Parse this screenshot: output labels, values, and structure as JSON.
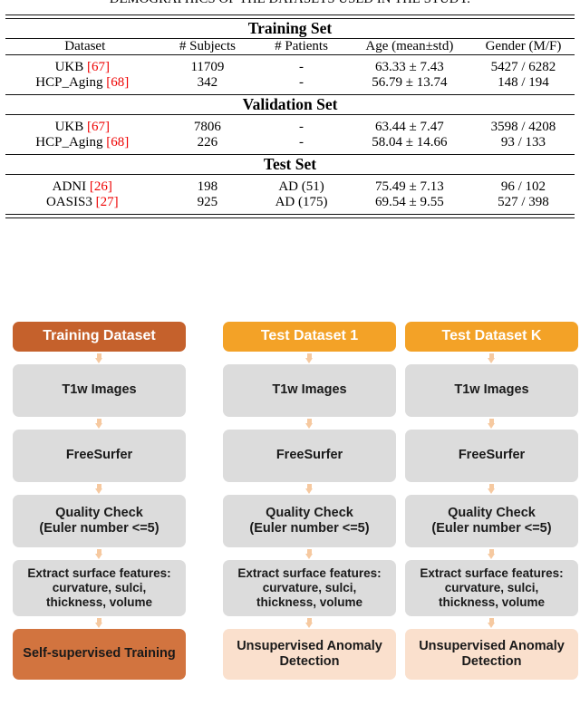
{
  "caption": "DEMOGRAPHICS OF THE DATASETS USED IN THE STUDY.",
  "table": {
    "columns": [
      "Dataset",
      "# Subjects",
      "# Patients",
      "Age (mean±std)",
      "Gender (M/F)"
    ],
    "sections": [
      {
        "title": "Training Set",
        "rows": [
          {
            "dataset": "UKB",
            "cite": "[67]",
            "subjects": "11709",
            "patients": "-",
            "age": "63.33 ± 7.43",
            "gender": "5427 / 6282"
          },
          {
            "dataset": "HCP_Aging",
            "cite": "[68]",
            "subjects": "342",
            "patients": "-",
            "age": "56.79 ± 13.74",
            "gender": "148 / 194"
          }
        ]
      },
      {
        "title": "Validation Set",
        "rows": [
          {
            "dataset": "UKB",
            "cite": "[67]",
            "subjects": "7806",
            "patients": "-",
            "age": "63.44 ± 7.47",
            "gender": "3598 / 4208"
          },
          {
            "dataset": "HCP_Aging",
            "cite": "[68]",
            "subjects": "226",
            "patients": "-",
            "age": "58.04 ± 14.66",
            "gender": "93 / 133"
          }
        ]
      },
      {
        "title": "Test Set",
        "rows": [
          {
            "dataset": "ADNI",
            "cite": "[26]",
            "subjects": "198",
            "patients": "AD (51)",
            "age": "75.49 ± 7.13",
            "gender": "96 / 102"
          },
          {
            "dataset": "OASIS3",
            "cite": "[27]",
            "subjects": "925",
            "patients": "AD (175)",
            "age": "69.54 ± 9.55",
            "gender": "527 / 398"
          }
        ]
      }
    ]
  },
  "flowchart": {
    "colors": {
      "training_header": "#c5612c",
      "test_header": "#f3a227",
      "process_box": "#dcdcdc",
      "result_solid": "#d2743f",
      "result_light": "#fae0cd",
      "arrow": "#f6c9a0"
    },
    "columns": [
      {
        "header": "Training Dataset",
        "steps": [
          {
            "label": "T1w Images"
          },
          {
            "label": "FreeSurfer"
          },
          {
            "line1": "Quality Check",
            "line2": "(Euler number <=5)"
          },
          {
            "line1": "Extract surface features:",
            "line2": "curvature, sulci,",
            "line3": "thickness, volume"
          }
        ],
        "result": {
          "line1": "Self-supervised Training",
          "line2": ""
        }
      },
      {
        "header": "Test Dataset 1",
        "steps": [
          {
            "label": "T1w Images"
          },
          {
            "label": "FreeSurfer"
          },
          {
            "line1": "Quality Check",
            "line2": "(Euler number <=5)"
          },
          {
            "line1": "Extract surface features:",
            "line2": "curvature, sulci,",
            "line3": "thickness, volume"
          }
        ],
        "result": {
          "line1": "Unsupervised Anomaly",
          "line2": "Detection"
        }
      },
      {
        "header": "Test Dataset K",
        "steps": [
          {
            "label": "T1w Images"
          },
          {
            "label": "FreeSurfer"
          },
          {
            "line1": "Quality Check",
            "line2": "(Euler number <=5)"
          },
          {
            "line1": "Extract surface features:",
            "line2": "curvature, sulci,",
            "line3": "thickness, volume"
          }
        ],
        "result": {
          "line1": "Unsupervised Anomaly",
          "line2": "Detection"
        }
      }
    ]
  }
}
